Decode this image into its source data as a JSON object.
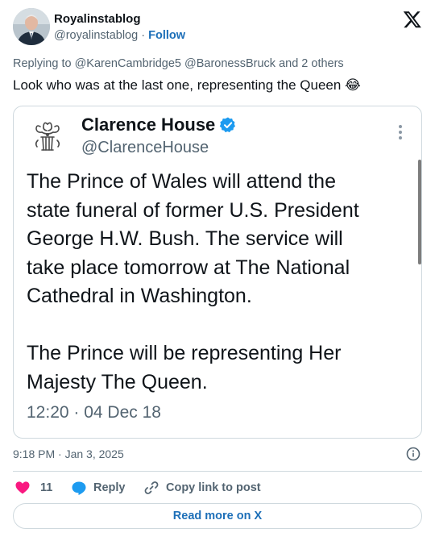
{
  "author": {
    "name": "Royalinstablog",
    "handle": "@royalinstablog",
    "separator": "·",
    "follow_label": "Follow",
    "avatar_icon": "portrait-avatar"
  },
  "platform_icon": "x-logo-icon",
  "tweet": {
    "replying_to": "Replying to @KarenCambridge5 @BaronessBruck and 2 others",
    "text": "Look who was at the last one, representing the Queen 😂"
  },
  "quoted": {
    "name": "Clarence House",
    "handle": "@ClarenceHouse",
    "verified_color": "#1d9bf0",
    "lines": [
      "The Prince of Wales will attend the",
      "state funeral of former U.S. President",
      "George H.W. Bush. The service will",
      "take place tomorrow at The National",
      "Cathedral in Washington."
    ],
    "lines2": [
      "The Prince will be representing Her",
      "Majesty The Queen."
    ],
    "timestamp": "12:20 · 04 Dec 18"
  },
  "meta": {
    "time": "9:18 PM · Jan 3, 2025"
  },
  "actions": {
    "likes": "11",
    "reply_label": "Reply",
    "copy_label": "Copy link to post",
    "heart_color": "#f91880",
    "reply_icon_color": "#1d9bf0"
  },
  "read_more_label": "Read more on X",
  "colors": {
    "text": "#0f1419",
    "secondary": "#536471",
    "link": "#1d6fb8",
    "border": "#cfd9de"
  }
}
